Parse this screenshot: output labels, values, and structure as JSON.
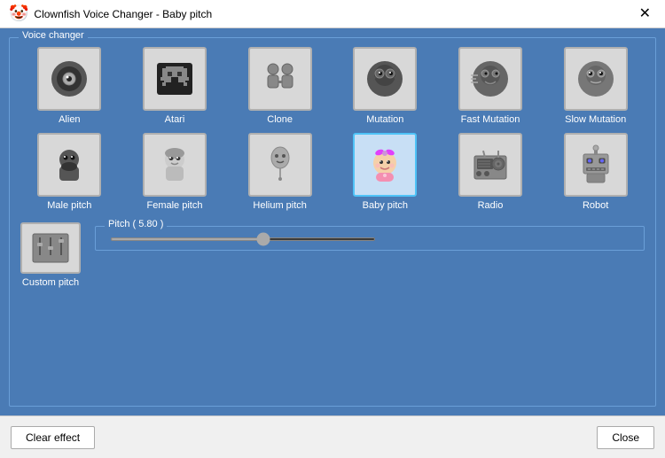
{
  "titleBar": {
    "icon": "🤡",
    "title": "Clownfish Voice Changer - Baby pitch",
    "closeLabel": "✕"
  },
  "groupBox": {
    "legend": "Voice changer"
  },
  "voiceItems": [
    {
      "id": "alien",
      "label": "Alien",
      "selected": false,
      "icon": "alien"
    },
    {
      "id": "atari",
      "label": "Atari",
      "selected": false,
      "icon": "atari"
    },
    {
      "id": "clone",
      "label": "Clone",
      "selected": false,
      "icon": "clone"
    },
    {
      "id": "mutation",
      "label": "Mutation",
      "selected": false,
      "icon": "mutation"
    },
    {
      "id": "fast-mutation",
      "label": "Fast\nMutation",
      "selected": false,
      "icon": "fast-mutation"
    },
    {
      "id": "slow-mutation",
      "label": "Slow\nMutation",
      "selected": false,
      "icon": "slow-mutation"
    },
    {
      "id": "male-pitch",
      "label": "Male pitch",
      "selected": false,
      "icon": "male-pitch"
    },
    {
      "id": "female-pitch",
      "label": "Female pitch",
      "selected": false,
      "icon": "female-pitch"
    },
    {
      "id": "helium-pitch",
      "label": "Helium pitch",
      "selected": false,
      "icon": "helium-pitch"
    },
    {
      "id": "baby-pitch",
      "label": "Baby pitch",
      "selected": true,
      "icon": "baby-pitch"
    },
    {
      "id": "radio",
      "label": "Radio",
      "selected": false,
      "icon": "radio"
    },
    {
      "id": "robot",
      "label": "Robot",
      "selected": false,
      "icon": "robot"
    }
  ],
  "customPitch": {
    "label": "Custom pitch",
    "icon": "custom"
  },
  "pitchSlider": {
    "legend": "Pitch ( 5.80 )",
    "value": 58,
    "min": 0,
    "max": 100
  },
  "buttons": {
    "clearEffect": "Clear effect",
    "close": "Close"
  }
}
